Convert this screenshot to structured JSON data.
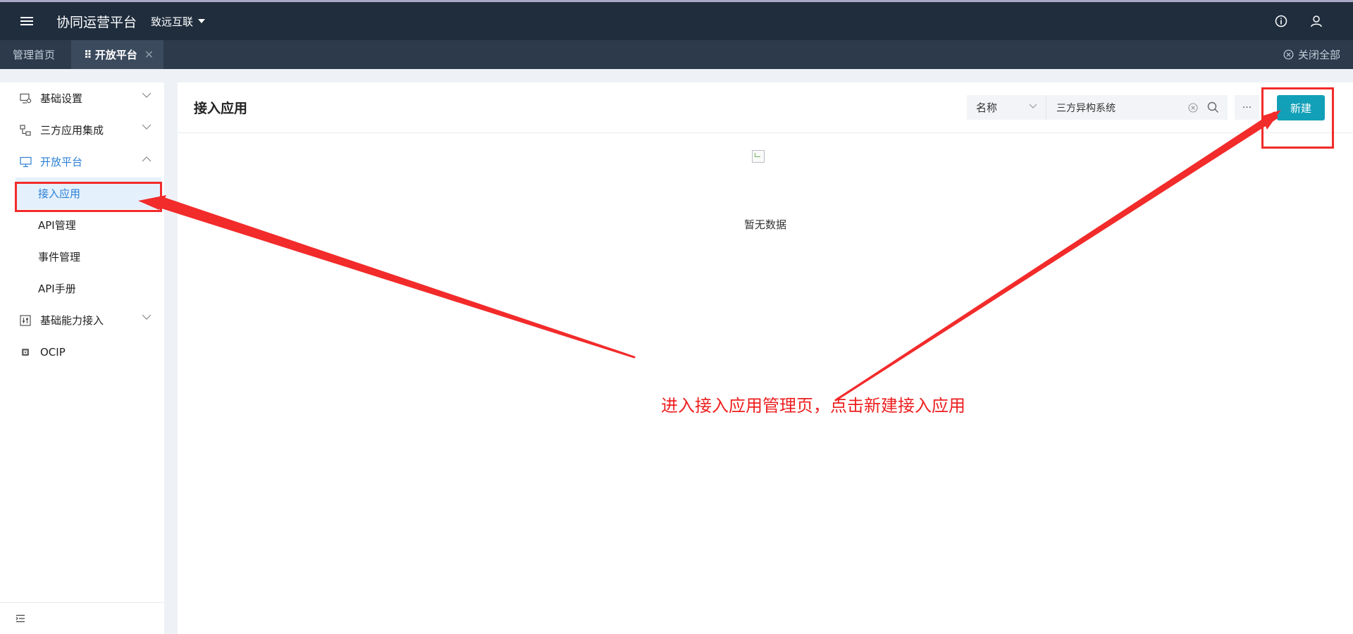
{
  "header": {
    "app_title": "协同运营平台",
    "org_name": "致远互联"
  },
  "tabs": [
    {
      "label": "管理首页",
      "active": false
    },
    {
      "label": "开放平台",
      "active": true
    }
  ],
  "tabbar": {
    "close_all": "关闭全部"
  },
  "sidebar": {
    "items": [
      {
        "label": "基础设置",
        "icon": "settings-monitor-icon",
        "expandable": true
      },
      {
        "label": "三方应用集成",
        "icon": "integration-icon",
        "expandable": true
      },
      {
        "label": "开放平台",
        "icon": "monitor-icon",
        "expandable": true,
        "open": true,
        "children": [
          {
            "label": "接入应用",
            "active": true
          },
          {
            "label": "API管理"
          },
          {
            "label": "事件管理"
          },
          {
            "label": "API手册"
          }
        ]
      },
      {
        "label": "基础能力接入",
        "icon": "sliders-icon",
        "expandable": true
      },
      {
        "label": "OCIP",
        "icon": "chip-icon",
        "expandable": false
      }
    ]
  },
  "main": {
    "title": "接入应用",
    "search": {
      "field": "名称",
      "value": "三方异构系统"
    },
    "more_label": "···",
    "new_button": "新建",
    "empty_text": "暂无数据"
  },
  "annotation": {
    "text": "进入接入应用管理页，点击新建接入应用",
    "color": "#ee1f1f"
  },
  "colors": {
    "topbar": "#1f2d3d",
    "tabbar": "#2c3a4c",
    "accent": "#2b7fd4",
    "primary_button": "#12a0b8"
  }
}
